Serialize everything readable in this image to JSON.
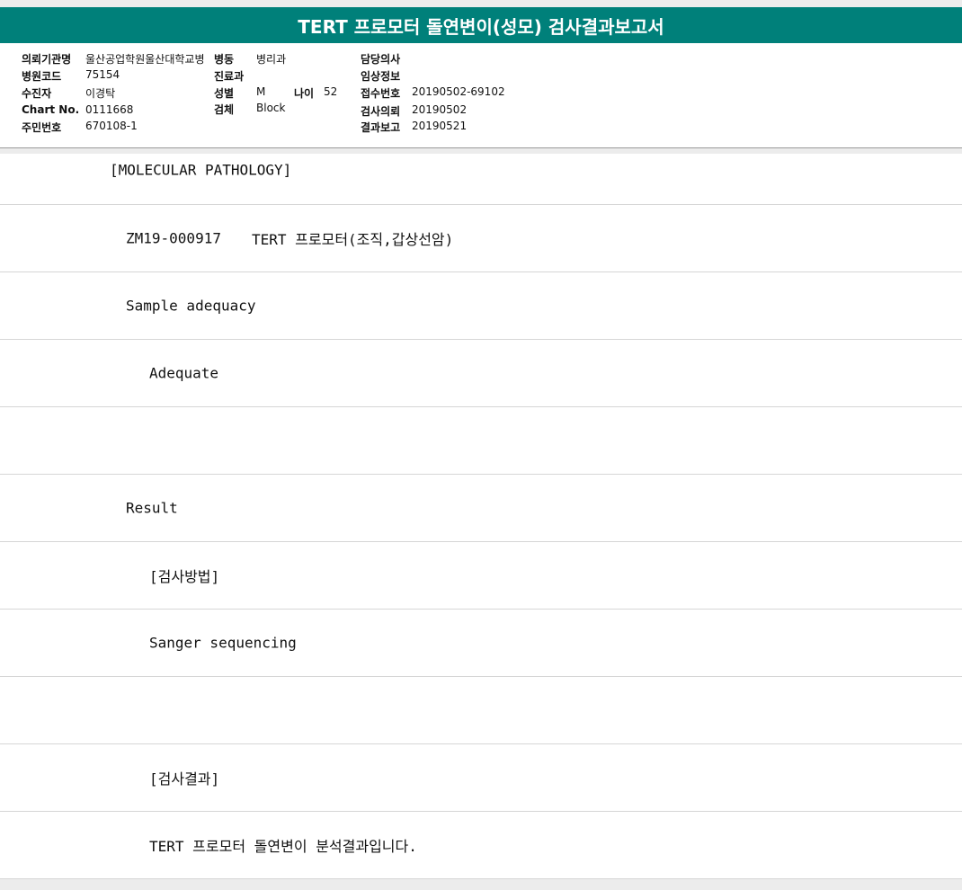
{
  "report": {
    "title": "TERT 프로모터 돌연변이(성모) 검사결과보고서"
  },
  "info": {
    "institution_label": "의뢰기관명",
    "institution_value": "울산공업학원울산대학교병",
    "ward_label": "병동",
    "ward_value": "병리과",
    "doctor_label": "담당의사",
    "doctor_value": "",
    "hospital_code_label": "병원코드",
    "hospital_code_value": "75154",
    "department_label": "진료과",
    "department_value": "",
    "clinical_info_label": "임상정보",
    "clinical_info_value": "",
    "patient_label": "수진자",
    "patient_value": "이경탁",
    "sex_label": "성별",
    "sex_value": "M",
    "age_label": "나이",
    "age_value": "52",
    "accession_label": "접수번호",
    "accession_value": "20190502-69102",
    "chart_label": "Chart No.",
    "chart_value": "0111668",
    "specimen_label": "검체",
    "specimen_value": "Block",
    "request_date_label": "검사의뢰",
    "request_date_value": "20190502",
    "resident_label": "주민번호",
    "resident_value": "670108-1",
    "report_date_label": "결과보고",
    "report_date_value": "20190521"
  },
  "body": {
    "section_header": "[MOLECULAR PATHOLOGY]",
    "test_id": "ZM19-000917",
    "test_name": "TERT 프로모터(조직,갑상선암)",
    "sample_adequacy_label": "Sample adequacy",
    "sample_adequacy_value": "Adequate",
    "result_label": "Result",
    "method_header": "[검사방법]",
    "method_value": "Sanger sequencing",
    "result_header": "[검사결과]",
    "result_text": "TERT 프로모터 돌연변이 분석결과입니다."
  }
}
